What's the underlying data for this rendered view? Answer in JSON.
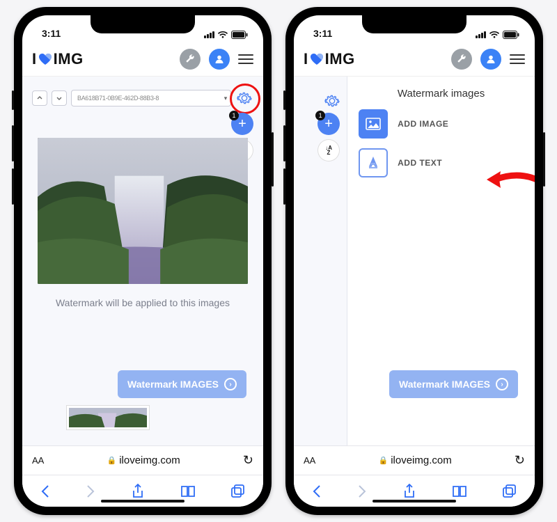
{
  "status": {
    "time": "3:11"
  },
  "logo": {
    "prefix": "I",
    "suffix": "IMG"
  },
  "file": {
    "name": "BA618B71-0B9E-462D-88B3-8"
  },
  "badge": {
    "count": "1"
  },
  "sort": {
    "label": "AZ"
  },
  "caption": {
    "text": "Watermark will be applied to this images"
  },
  "cta": {
    "label": "Watermark IMAGES"
  },
  "browser": {
    "aa": "AA",
    "url": "iloveimg.com"
  },
  "panel": {
    "title": "Watermark images",
    "add_image": "ADD IMAGE",
    "add_text": "ADD TEXT"
  }
}
